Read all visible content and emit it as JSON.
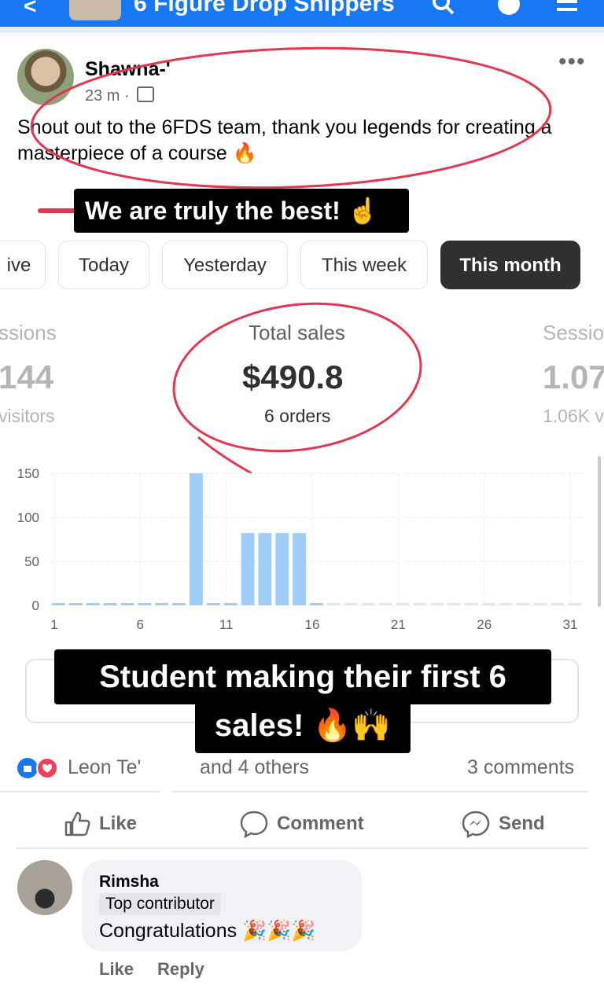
{
  "header": {
    "group_title": "6 Figure Drop Shippers",
    "icons": [
      "back-arrow-icon",
      "search-icon",
      "profile-icon",
      "menu-icon"
    ],
    "accent": "#1877f2"
  },
  "post": {
    "author": "Shawna-'",
    "time": "23 m ·",
    "text": "Shout out to the 6FDS team, thank you legends for creating a masterpiece of a course 🔥",
    "more": "•••"
  },
  "captions": {
    "top": "We are truly the best! ☝️",
    "bottom_line1": "Student making their first 6",
    "bottom_line2": "sales! 🔥🙌"
  },
  "dashboard": {
    "tabs": [
      {
        "label": "ive",
        "active": false
      },
      {
        "label": "Today",
        "active": false
      },
      {
        "label": "Yesterday",
        "active": false
      },
      {
        "label": "This week",
        "active": false
      },
      {
        "label": "This month",
        "active": true
      }
    ],
    "metrics": [
      {
        "label": "ssions",
        "value": "144",
        "sub": "visitors"
      },
      {
        "label": "Total sales",
        "value": "$490.8",
        "sub": "6 orders"
      },
      {
        "label": "Sessio",
        "value": "1.07",
        "sub": "1.06K v"
      }
    ]
  },
  "chart_data": {
    "type": "bar",
    "x": [
      1,
      2,
      3,
      4,
      5,
      6,
      7,
      8,
      9,
      10,
      11,
      12,
      13,
      14,
      15,
      16,
      17,
      18,
      19,
      20,
      21,
      22,
      23,
      24,
      25,
      26,
      27,
      28,
      29,
      30,
      31
    ],
    "values": [
      0,
      0,
      0,
      0,
      0,
      0,
      0,
      0,
      150,
      0,
      0,
      82,
      82,
      82,
      82,
      0,
      0,
      0,
      0,
      0,
      0,
      0,
      0,
      0,
      0,
      0,
      0,
      0,
      0,
      0,
      0
    ],
    "x_ticks": [
      "1",
      "6",
      "11",
      "16",
      "21",
      "26",
      "31"
    ],
    "y_ticks": [
      "0",
      "50",
      "100",
      "150"
    ],
    "ylim": [
      0,
      150
    ],
    "grid": true,
    "bar_color": "#9fcdf7"
  },
  "reactions": {
    "names": "Leon Te'",
    "others": "and 4 others",
    "comments": "3 comments"
  },
  "actions": {
    "like": "Like",
    "comment": "Comment",
    "send": "Send"
  },
  "comment": {
    "author": "Rimsha",
    "badge": "Top contributor",
    "text": "Congratulations 🎉🎉🎉",
    "like": "Like",
    "reply": "Reply"
  }
}
